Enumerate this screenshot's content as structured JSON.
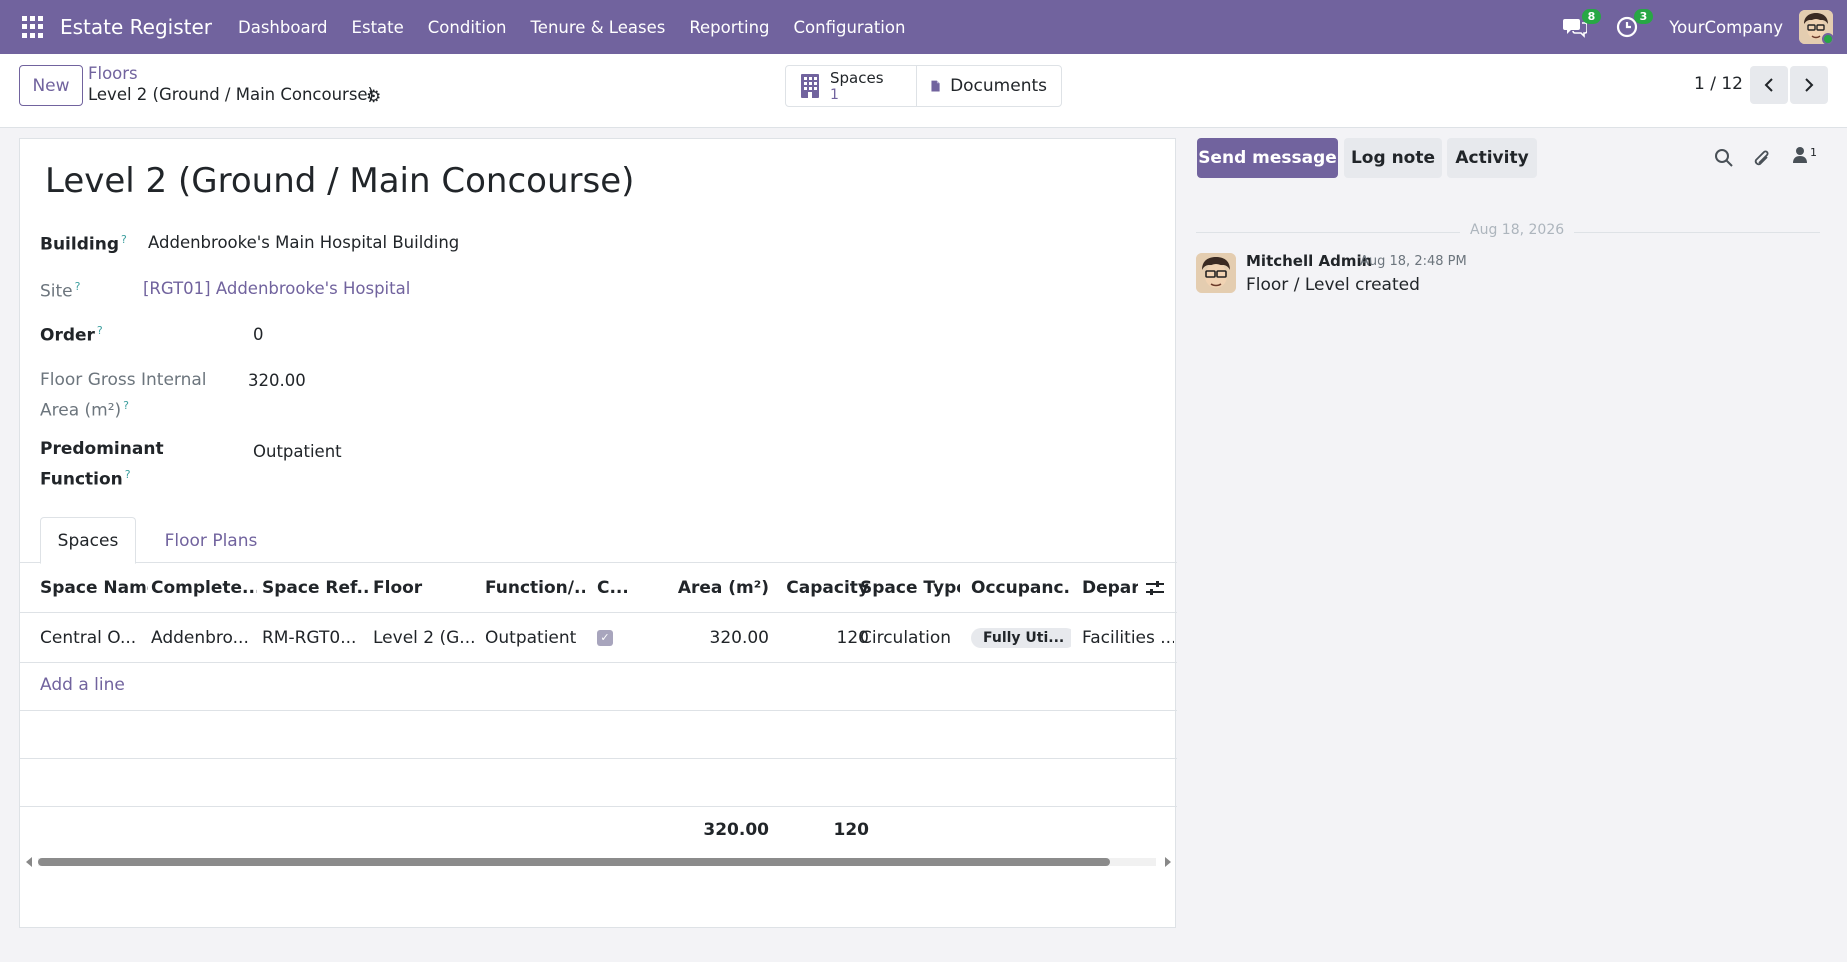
{
  "navbar": {
    "app_name": "Estate Register",
    "menu": [
      "Dashboard",
      "Estate",
      "Condition",
      "Tenure & Leases",
      "Reporting",
      "Configuration"
    ],
    "messages_count": "8",
    "activities_count": "3",
    "company": "YourCompany"
  },
  "control_panel": {
    "new_label": "New",
    "breadcrumb_parent": "Floors",
    "breadcrumb_current": "Level 2 (Ground / Main Concourse)",
    "smart_buttons": {
      "spaces_label": "Spaces",
      "spaces_count": "1",
      "documents_label": "Documents"
    },
    "pager": "1 / 12"
  },
  "form": {
    "title": "Level 2 (Ground / Main Concourse)",
    "fields": {
      "building_label": "Building",
      "building_value": "Addenbrooke's Main Hospital Building",
      "site_label": "Site",
      "site_value": "[RGT01] Addenbrooke's Hospital",
      "order_label": "Order",
      "order_value": "0",
      "gia_label_line1": "Floor Gross Internal",
      "gia_label_line2": "Area (m²)",
      "gia_value": "320.00",
      "function_label_line1": "Predominant",
      "function_label_line2": "Function",
      "function_value": "Outpatient"
    },
    "help_marker": "?",
    "tabs": [
      "Spaces",
      "Floor Plans"
    ],
    "table": {
      "columns": [
        "Space Name",
        "Complete...",
        "Space Ref...",
        "Floor",
        "Function/...",
        "C...",
        "Area (m²)",
        "Capacity",
        "Space Type",
        "Occupanc...",
        "Depart"
      ],
      "rows": [
        {
          "space_name": "Central O...",
          "complete": "Addenbro...",
          "space_ref": "RM-RGT0...",
          "floor": "Level 2 (G...",
          "function": "Outpatient",
          "checked": true,
          "area": "320.00",
          "capacity": "120",
          "space_type": "Circulation",
          "occupancy": "Fully Uti...",
          "department": "Facilities ..."
        }
      ],
      "add_line": "Add a line",
      "totals": {
        "area": "320.00",
        "capacity": "120"
      }
    }
  },
  "chatter": {
    "send_message": "Send message",
    "log_note": "Log note",
    "activity": "Activity",
    "followers_count": "1",
    "date_separator": "Aug 18, 2026",
    "message": {
      "author": "Mitchell Admin",
      "date": "Aug 18, 2:48 PM",
      "body": "Floor / Level created"
    }
  },
  "colors": {
    "brand": "#71639e",
    "badge_green": "#28a745"
  }
}
